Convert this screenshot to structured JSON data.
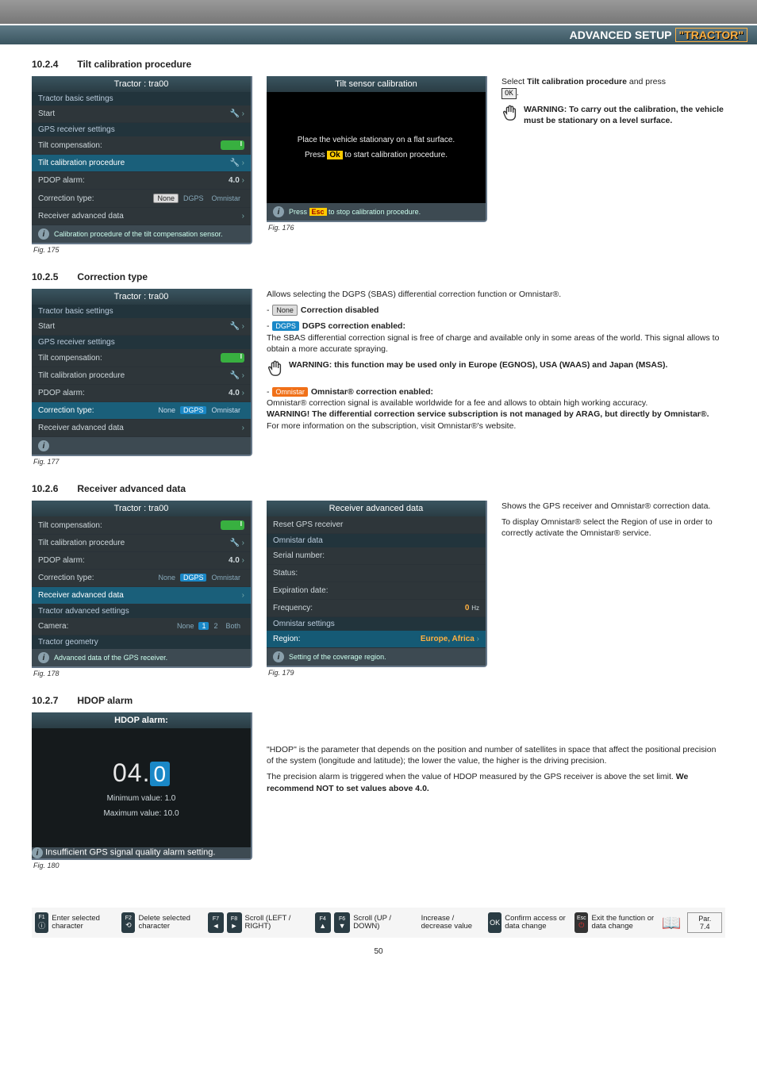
{
  "header": {
    "title_prefix": "ADVANCED SETUP",
    "title_quoted": "\"TRACTOR\""
  },
  "sections": {
    "s1024": {
      "num": "10.2.4",
      "title": "Tilt calibration procedure"
    },
    "s1025": {
      "num": "10.2.5",
      "title": "Correction type"
    },
    "s1026": {
      "num": "10.2.6",
      "title": "Receiver advanced data"
    },
    "s1027": {
      "num": "10.2.7",
      "title": "HDOP alarm"
    }
  },
  "fig175": {
    "title": "Tractor : tra00",
    "group1": "Tractor basic settings",
    "start": "Start",
    "group2": "GPS receiver settings",
    "tilt_comp": "Tilt compensation:",
    "tilt_cal": "Tilt calibration procedure",
    "pdop": "PDOP alarm:",
    "pdop_val": "4.0",
    "corr": "Correction type:",
    "corr_opts": {
      "none": "None",
      "dgps": "DGPS",
      "om": "Omnistar"
    },
    "rad": "Receiver advanced data",
    "foot": "Calibration procedure of the tilt compensation sensor.",
    "label": "Fig. 175"
  },
  "fig176": {
    "title": "Tilt sensor calibration",
    "line1": "Place the vehicle stationary on a flat surface.",
    "line2a": "Press ",
    "line2b": " to start calibration procedure.",
    "ok": "Ok",
    "foot_a": "Press ",
    "foot_b": " to stop calibration procedure.",
    "esc": "Esc",
    "label": "Fig. 176"
  },
  "side1024": {
    "p1a": "Select ",
    "p1b": "Tilt calibration procedure",
    "p1c": " and press",
    "ok": "OK",
    "warn": "WARNING: To carry out the calibration, the vehicle must be stationary on a level surface."
  },
  "fig177": {
    "title": "Tractor : tra00",
    "group1": "Tractor basic settings",
    "start": "Start",
    "group2": "GPS receiver settings",
    "tilt_comp": "Tilt compensation:",
    "tilt_cal": "Tilt calibration procedure",
    "pdop": "PDOP alarm:",
    "pdop_val": "4.0",
    "corr": "Correction type:",
    "corr_opts": {
      "none": "None",
      "dgps": "DGPS",
      "om": "Omnistar"
    },
    "rad": "Receiver advanced data",
    "label": "Fig. 177"
  },
  "side1025": {
    "intro": "Allows selecting the DGPS (SBAS) differential correction function or Omnistar®.",
    "none_lbl": "None",
    "none_after": " Correction disabled",
    "dgps_lbl": "DGPS",
    "dgps_after": " DGPS correction enabled:",
    "dgps_body": "The SBAS differential correction signal is free of charge and available only in some areas of the world. This signal allows to obtain a more accurate spraying.",
    "dgps_warn": "WARNING: this function may be used only in Europe (EGNOS), USA (WAAS) and Japan (MSAS).",
    "om_lbl": "Omnistar",
    "om_after": " Omnistar® correction enabled:",
    "om_body1": "Omnistar® correction signal is available worldwide for a fee and allows to obtain high working accuracy.",
    "om_body2": "WARNING! The differential correction service subscription is not managed by ARAG, but directly by Omnistar®.",
    "om_body3": "For more information on the subscription, visit Omnistar®'s website."
  },
  "fig178": {
    "title": "Tractor : tra00",
    "tilt_comp": "Tilt compensation:",
    "tilt_cal": "Tilt calibration procedure",
    "pdop": "PDOP alarm:",
    "pdop_val": "4.0",
    "corr": "Correction type:",
    "corr_opts": {
      "none": "None",
      "dgps": "DGPS",
      "om": "Omnistar"
    },
    "rad": "Receiver advanced data",
    "group_adv": "Tractor advanced settings",
    "camera": "Camera:",
    "cam_opts": {
      "none": "None",
      "one": "1",
      "two": "2",
      "both": "Both"
    },
    "group_geo": "Tractor geometry",
    "foot": "Advanced data of the GPS receiver.",
    "label": "Fig. 178"
  },
  "fig179": {
    "title": "Receiver advanced data",
    "reset": "Reset GPS receiver",
    "group_od": "Omnistar data",
    "sn": "Serial number:",
    "status": "Status:",
    "exp": "Expiration date:",
    "freq": "Frequency:",
    "freq_val": "0",
    "freq_unit": "Hz",
    "group_os": "Omnistar settings",
    "region": "Region:",
    "region_val": "Europe, Africa",
    "foot": "Setting of the coverage region.",
    "label": "Fig. 179"
  },
  "side1026": {
    "p1": "Shows the GPS receiver and Omnistar® correction data.",
    "p2": "To display Omnistar® select the Region of use in order to correctly activate the Omnistar® service."
  },
  "fig180": {
    "title": "HDOP alarm:",
    "val_int": "04",
    "val_dot": ".",
    "val_frac": "0",
    "min": "Minimum value:  1.0",
    "max": "Maximum value:  10.0",
    "foot": "Insufficient GPS signal quality alarm setting.",
    "label": "Fig. 180"
  },
  "side1027": {
    "p1": "\"HDOP\" is the parameter that depends on the position and number of satellites in space that affect the positional precision of the system (longitude and latitude); the lower the value, the higher is the driving precision.",
    "p2a": "The precision alarm is triggered when the value of HDOP measured by the GPS receiver is above the set limit. ",
    "p2b": "We recommend NOT to set values above 4.0."
  },
  "footer": {
    "f1": "F1",
    "f1_lbl": "Enter selected character",
    "f2": "F2",
    "f2_lbl": "Delete selected character",
    "f7": "F7",
    "f8": "F8",
    "scroll_lr": "Scroll (LEFT / RIGHT)",
    "f4": "F4",
    "f6": "F6",
    "scroll_ud": "Scroll (UP / DOWN)",
    "incdec": "Increase / decrease value",
    "ok": "OK",
    "ok_lbl": "Confirm access or data change",
    "esc": "Esc",
    "esc_lbl": "Exit the function or data change",
    "par": "Par. 7.4",
    "pagenum": "50"
  }
}
